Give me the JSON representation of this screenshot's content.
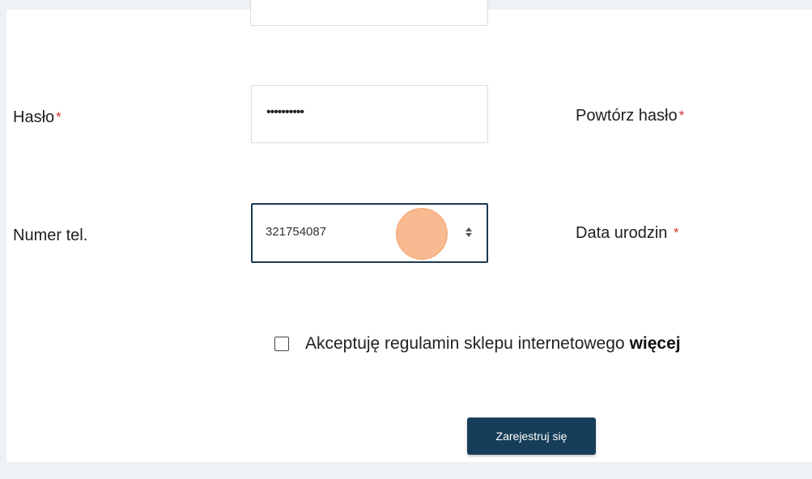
{
  "form": {
    "password": {
      "label": "Hasło",
      "required_mark": "*",
      "masked_value": "••••••••••"
    },
    "repeat_password": {
      "label": "Powtórz hasło",
      "required_mark": "*"
    },
    "phone": {
      "label": "Numer tel.",
      "value": "321754087"
    },
    "birth_date": {
      "label": "Data urodzin",
      "required_mark": "*"
    },
    "terms": {
      "text": "Akceptuję regulamin sklepu internetowego",
      "more_link": "więcej",
      "checked": false
    },
    "submit_label": "Zarejestruj się"
  },
  "colors": {
    "background": "#eef1f6",
    "panel": "#ffffff",
    "required": "#d0352b",
    "focus_border": "#1b3a52",
    "button": "#173e59",
    "cursor_highlight": "#f7b07e"
  }
}
